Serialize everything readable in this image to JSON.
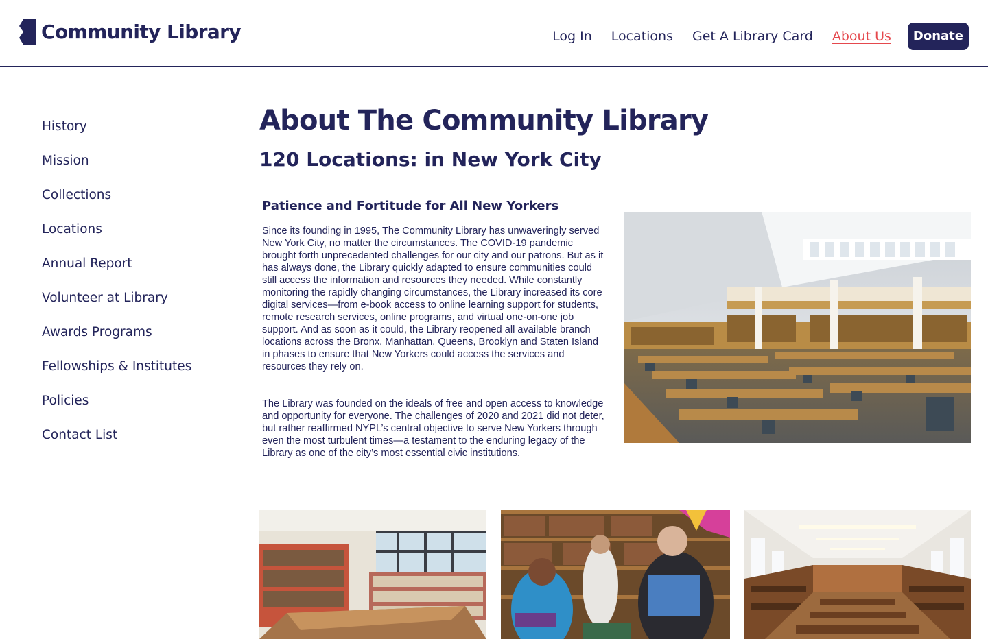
{
  "header": {
    "logo_text": "Community Library",
    "nav": {
      "login": "Log In",
      "locations": "Locations",
      "library_card": "Get A Library Card",
      "about": "About Us",
      "donate": "Donate"
    }
  },
  "sidebar": {
    "items": [
      {
        "label": "History"
      },
      {
        "label": "Mission"
      },
      {
        "label": "Collections"
      },
      {
        "label": "Locations"
      },
      {
        "label": "Annual Report"
      },
      {
        "label": "Volunteer at Library"
      },
      {
        "label": "Awards Programs"
      },
      {
        "label": "Fellowships & Institutes"
      },
      {
        "label": "Policies"
      },
      {
        "label": "Contact List"
      }
    ]
  },
  "main": {
    "title": "About The Community Library",
    "subtitle": "120 Locations: in New York City",
    "section": {
      "heading": "Patience and Fortitude for All New Yorkers",
      "paragraphs": [
        "Since its founding in 1995, The Community Library has unwaveringly served New York City, no matter the circumstances. The COVID-19 pandemic brought forth unprecedented challenges for our city and our patrons. But as it has always done, the Library quickly adapted to ensure communities could still access the information and resources they needed. While constantly monitoring the rapidly changing circumstances, the Library increased its core digital services—from e-book access to online learning support for students, remote research services, online programs, and virtual one-on-one job support. And as soon as it could, the Library reopened all available branch locations across the Bronx, Manhattan, Queens, Brooklyn and Staten Island in phases to ensure that New Yorkers could access the services and resources they rely on.",
        "The Library was founded on the ideals of free and open access to knowledge and opportunity for everyone. The challenges of 2020 and 2021 did not deter, but rather reaffirmed NYPL’s central objective to serve New Yorkers through even the most turbulent times—a testament to the enduring legacy of the Library as one of the city’s most essential civic institutions."
      ]
    }
  },
  "colors": {
    "brand_navy": "#23245a",
    "active_link": "#e5484d",
    "background": "#ffffff"
  },
  "icons": {
    "logo": "bookmark-logo-icon"
  }
}
